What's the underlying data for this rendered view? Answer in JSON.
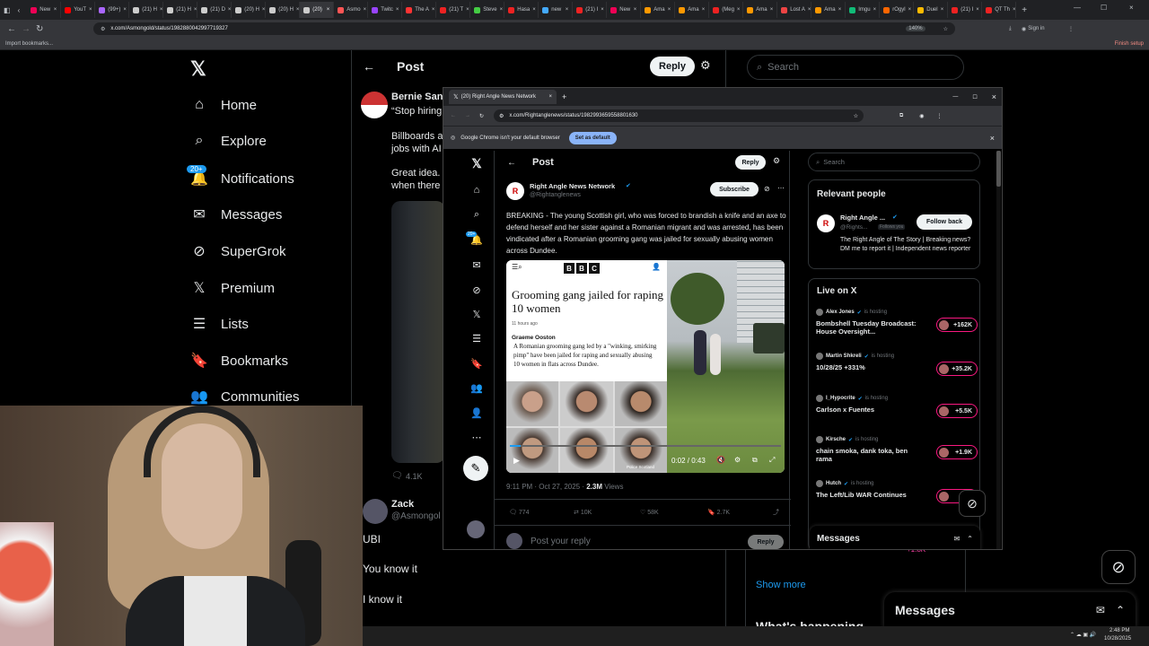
{
  "browser": {
    "tabs": [
      {
        "label": "New",
        "color": "#e05"
      },
      {
        "label": "YouT",
        "color": "#f00"
      },
      {
        "label": "(99+)",
        "color": "#a6f"
      },
      {
        "label": "(21) H",
        "color": "#ccc"
      },
      {
        "label": "(21) H",
        "color": "#ccc"
      },
      {
        "label": "(21) D",
        "color": "#ccc"
      },
      {
        "label": "(20) H",
        "color": "#ccc"
      },
      {
        "label": "(20) H",
        "color": "#ccc"
      },
      {
        "label": "(20)",
        "color": "#ccc",
        "active": true
      },
      {
        "label": "Asmo",
        "color": "#f55"
      },
      {
        "label": "Twitc",
        "color": "#94f"
      },
      {
        "label": "The A",
        "color": "#f33"
      },
      {
        "label": "(21) T",
        "color": "#e22"
      },
      {
        "label": "Steve",
        "color": "#4c4"
      },
      {
        "label": "Hasa",
        "color": "#e22"
      },
      {
        "label": "new",
        "color": "#4af"
      },
      {
        "label": "(21) I",
        "color": "#e22"
      },
      {
        "label": "New",
        "color": "#e05"
      },
      {
        "label": "Ama",
        "color": "#f90"
      },
      {
        "label": "Ama",
        "color": "#f90"
      },
      {
        "label": "(Meg",
        "color": "#e22"
      },
      {
        "label": "Ama",
        "color": "#f90"
      },
      {
        "label": "Lost A",
        "color": "#e44"
      },
      {
        "label": "Ama",
        "color": "#f90"
      },
      {
        "label": "Imgu",
        "color": "#1b7"
      },
      {
        "label": "rOgyl",
        "color": "#f60"
      },
      {
        "label": "Duel",
        "color": "#fb0"
      },
      {
        "label": "(21) I",
        "color": "#e22"
      },
      {
        "label": "QT Th",
        "color": "#e22"
      }
    ],
    "url": "x.com/Asmongold/status/1982880042997719327",
    "zoom": "140%",
    "sign_in": "Sign in",
    "import_bookmarks": "Import bookmarks...",
    "finish_setup": "Finish setup"
  },
  "nav": {
    "items": [
      {
        "label": "Home",
        "icon": "home-icon",
        "glyph": "⌂"
      },
      {
        "label": "Explore",
        "icon": "search-icon",
        "glyph": "⌕"
      },
      {
        "label": "Notifications",
        "icon": "bell-icon",
        "glyph": "🔔"
      },
      {
        "label": "Messages",
        "icon": "mail-icon",
        "glyph": "✉"
      },
      {
        "label": "SuperGrok",
        "icon": "grok-icon",
        "glyph": "⊘"
      },
      {
        "label": "Premium",
        "icon": "x-logo-icon",
        "glyph": "𝕏"
      },
      {
        "label": "Lists",
        "icon": "list-icon",
        "glyph": "☰"
      },
      {
        "label": "Bookmarks",
        "icon": "bookmark-icon",
        "glyph": "🔖"
      },
      {
        "label": "Communities",
        "icon": "people-icon",
        "glyph": "👥"
      }
    ],
    "notif_badge": "20+"
  },
  "main_post": {
    "header": "Post",
    "reply_label": "Reply",
    "author": "Bernie Sand",
    "text1": "“Stop hiring",
    "text2a": "Billboards a",
    "text2b": "jobs with AI",
    "text3a": "Great idea. C",
    "text3b": "when there",
    "likes": "4.1K",
    "reply_author": "Zack",
    "reply_handle": "@Asmongol",
    "comment1": "UBI",
    "comment2": "You know it",
    "comment3": "I know it"
  },
  "right_col": {
    "search_placeholder": "Search",
    "show_more": "Show more",
    "trend_partial": "What's happening",
    "msg_count": "+1.8K",
    "messages_label": "Messages"
  },
  "popup": {
    "tab_title": "(20) Right Angle News Network",
    "url": "x.com/Rightanglenews/status/1982993659558801630",
    "default_msg": "Google Chrome isn't your default browser",
    "set_default": "Set as default",
    "post_header": "Post",
    "reply_label": "Reply",
    "author": "Right Angle News Network",
    "handle": "@Rightanglenews",
    "subscribe": "Subscribe",
    "tweet_text": "BREAKING - The young Scottish girl, who was forced to brandish a knife and an axe to defend herself and her sister against a Romanian migrant and was arrested, has been vindicated after a Romanian grooming gang was jailed for sexually abusing women across Dundee.",
    "bbc": {
      "logo": "BBC",
      "headline": "Grooming gang jailed for raping 10 women",
      "time": "11 hours ago",
      "byline": "Graeme Ooston",
      "body": "A Romanian grooming gang led by a \"winking, smirking pimp\" have been jailed for raping and sexually abusing 10 women in flats across Dundee.",
      "credit": "Police Scotland"
    },
    "video_time": "0:02 / 0:43",
    "timestamp": "9:11 PM · Oct 27, 2025 · ",
    "views_num": "2.3M",
    "views_label": " Views",
    "stats": {
      "replies": "774",
      "reposts": "10K",
      "likes": "58K",
      "bookmarks": "2.7K"
    },
    "reply_placeholder": "Post your reply",
    "reply_button": "Reply",
    "notif_badge": "20+",
    "search_placeholder": "Search",
    "relevant_title": "Relevant people",
    "rp_name": "Right Angle ...",
    "rp_handle": "@Rights...",
    "rp_follows": "Follows you",
    "follow_back": "Follow back",
    "rp_bio": "The Right Angle of The Story | Breaking news? DM me to report it | Independent news reporter",
    "live_title": "Live on X",
    "lives": [
      {
        "host": "Alex Jones",
        "status": "is hosting",
        "title": "Bombshell Tuesday Broadcast: House Oversight...",
        "count": "+162K"
      },
      {
        "host": "Martin Shkreli",
        "status": "is hosting",
        "title": "10/28/25 +331%",
        "count": "+35.2K"
      },
      {
        "host": "I_Hypocrite",
        "status": "is hosting",
        "title": "Carlson x Fuentes",
        "count": "+5.5K"
      },
      {
        "host": "Kirsche",
        "status": "is hosting",
        "title": "chain smoka, dank toka, ben rama",
        "count": "+1.9K"
      },
      {
        "host": "Hutch",
        "status": "is hosting",
        "title": "The Left/Lib WAR Continues",
        "count": "+1."
      }
    ],
    "messages_label": "Messages"
  },
  "taskbar": {
    "time": "2:48 PM",
    "date": "10/28/2025"
  }
}
